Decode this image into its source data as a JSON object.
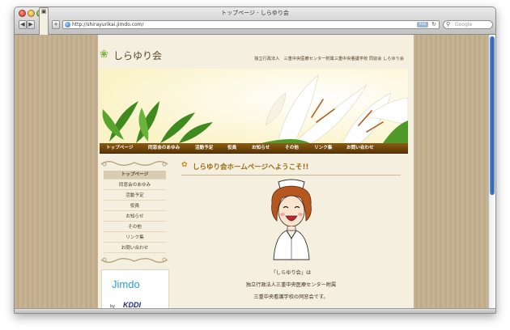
{
  "window": {
    "title": "トップページ - しらゆり会"
  },
  "toolbar": {
    "back_label": "◀",
    "forward_label": "▶",
    "page_label": "▣",
    "add_label": "+",
    "url": "http://shirayurikai.jimdo.com/",
    "rss_label": "RSS",
    "reload_label": "↻",
    "search_placeholder": "Google",
    "search_icon": "magnifier-icon"
  },
  "site": {
    "logo": "しらゆり会",
    "subtitle": "独立行政法人　三重中央医療センター附属三重中央看護学校 同窓会 しらゆり会"
  },
  "nav": [
    "トップページ",
    "同窓会のあゆみ",
    "活動予定",
    "役員",
    "お知らせ",
    "その他",
    "リンク集",
    "お問い合わせ"
  ],
  "sidebar": {
    "items": [
      "トップページ",
      "同窓会のあゆみ",
      "活動予定",
      "役員",
      "お知らせ",
      "その他",
      "リンク集",
      "お問い合わせ"
    ],
    "active_index": 0,
    "jimdo": "Jimdo",
    "by": "by",
    "kddi": "KDDI"
  },
  "main": {
    "heading": "しらゆり会ホームページへようこそ!!",
    "lines": [
      "「しらゆり会」は",
      "独立行政法人三重中央医療センター附属",
      "三重中央看護学校の同窓会です。"
    ]
  },
  "colors": {
    "accent": "#9a6a12",
    "nav_bg": "#6e4609",
    "page_bg": "#f5efe0"
  }
}
